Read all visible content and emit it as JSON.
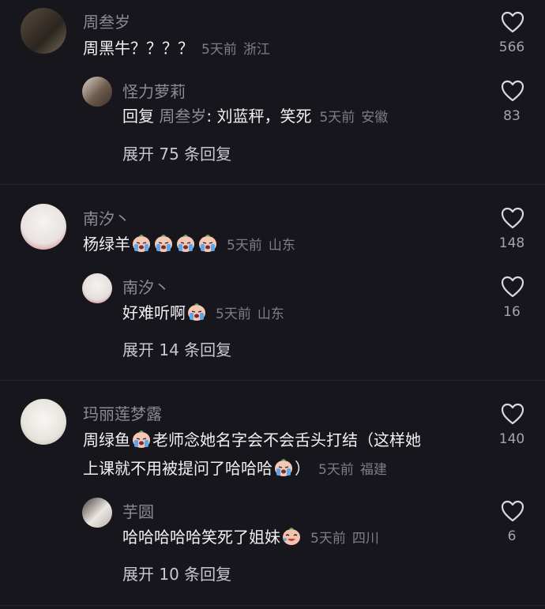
{
  "comments": [
    {
      "user": "周叁岁",
      "text": "周黑牛？？？？",
      "time": "5天前",
      "location": "浙江",
      "likes": "566",
      "reply": {
        "user": "怪力萝莉",
        "prefix": "回复",
        "target": "周叁岁",
        "text": ": 刘蓝秤，笑死",
        "time": "5天前",
        "location": "安徽",
        "likes": "83"
      },
      "expand": "展开 75 条回复"
    },
    {
      "user": "南汐丶",
      "text": "杨绿羊",
      "time": "5天前",
      "location": "山东",
      "likes": "148",
      "reply": {
        "user": "南汐丶",
        "text": "好难听啊",
        "time": "5天前",
        "location": "山东",
        "likes": "16"
      },
      "expand": "展开 14 条回复"
    },
    {
      "user": "玛丽莲梦露",
      "text_line1": "周绿鱼",
      "text_line1b": "老师念她名字会不会舌头打结（这样她",
      "text_line2": "上课就不用被提问了哈哈哈",
      "text_line2b": "）",
      "time": "5天前",
      "location": "福建",
      "likes": "140",
      "reply": {
        "user": "芋圆",
        "text": "哈哈哈哈哈笑死了姐妹",
        "time": "5天前",
        "location": "四川",
        "likes": "6"
      },
      "expand": "展开 10 条回复"
    }
  ],
  "colors": {
    "background": "#17161d",
    "text": "#f1f1f1",
    "muted": "#8c8b92"
  },
  "icons": {
    "like": "heart-outline-icon",
    "emoji_cry": "crying-face-emoji",
    "emoji_laugh": "laugh-cry-emoji"
  }
}
